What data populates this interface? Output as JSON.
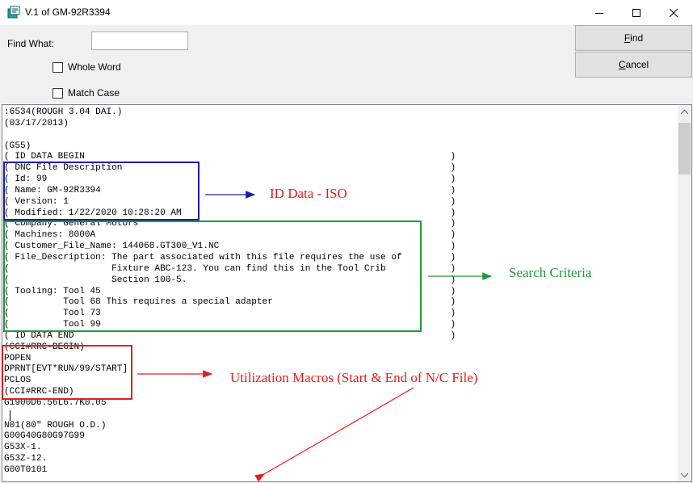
{
  "window": {
    "title": "V.1 of GM-92R3394",
    "controls": {
      "minimize": "minimize",
      "maximize": "maximize",
      "close": "close"
    }
  },
  "search": {
    "find_what_label": "Find What:",
    "find_value": "",
    "whole_word_label": "Whole Word",
    "match_case_label": "Match Case",
    "find_button": "Find",
    "cancel_button": "Cancel"
  },
  "code_lines": [
    ":6534(ROUGH 3.04 DAI.)",
    "(03/17/2013)",
    "",
    "(G55)",
    "( ID DATA BEGIN                                                                    )",
    "( DNC File Description                                                             )",
    "( Id: 99                                                                           )",
    "( Name: GM-92R3394                                                                 )",
    "( Version: 1                                                                       )",
    "( Modified: 1/22/2020 10:28:20 AM                                                  )",
    "( Company: General Motors                                                          )",
    "( Machines: 8000A                                                                  )",
    "( Customer_File_Name: 144068.GT300_V1.NC                                           )",
    "( File_Description: The part associated with this file requires the use of         )",
    "(                   Fixture ABC-123. You can find this in the Tool Crib            )",
    "(                   Section 100-5.                                                 )",
    "( Tooling: Tool 45                                                                 )",
    "(          Tool 68 This requires a special adapter                                 )",
    "(          Tool 73                                                                 )",
    "(          Tool 99                                                                 )",
    "( ID DATA END                                                                      )",
    "(CCI#RRC-BEGIN)",
    "POPEN",
    "DPRNT[EVT*RUN/99/START]",
    "PCLOS",
    "(CCI#RRC-END)",
    "G1900D6.56L6.7K0.05",
    "",
    "N01(80\" ROUGH O.D.)",
    "G00G40G80G97G99",
    "G53X-1.",
    "G53Z-12.",
    "G00T0101"
  ],
  "annotations": {
    "id_data": "ID Data - ISO",
    "search_criteria": "Search Criteria",
    "utilization_macros": "Utilization Macros (Start & End of N/C File)"
  },
  "colors": {
    "annotation_red": "#e61c1c",
    "annotation_green": "#1f9a3a",
    "annotation_blue": "#1b1bb0"
  }
}
